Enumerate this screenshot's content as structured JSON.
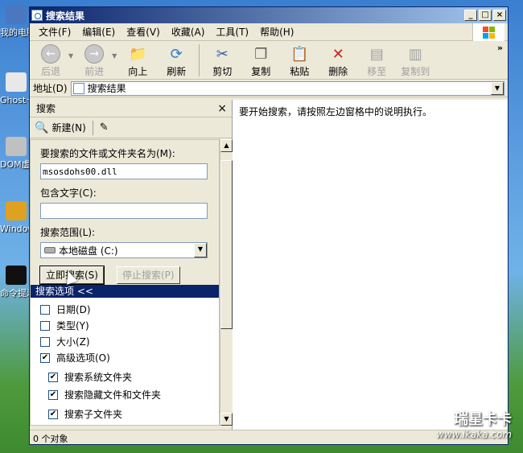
{
  "desktop": {
    "icons": [
      {
        "label": "我的电脑",
        "color": "#4a78c0"
      },
      {
        "label": "Ghost一键还原",
        "color": "#e8e8e8"
      },
      {
        "label": "DOM虚拟光驱",
        "color": "#c0c0c0"
      },
      {
        "label": "Windows密码",
        "color": "#e0a020"
      },
      {
        "label": "命令提示",
        "color": "#101010"
      }
    ]
  },
  "window": {
    "title": "搜索结果",
    "controls": {
      "minimize": "_",
      "maximize": "□",
      "close": "×"
    }
  },
  "menubar": [
    "文件(F)",
    "编辑(E)",
    "查看(V)",
    "收藏(A)",
    "工具(T)",
    "帮助(H)"
  ],
  "toolbar": {
    "back": "后退",
    "forward": "前进",
    "up": "向上",
    "refresh": "刷新",
    "cut": "剪切",
    "copy": "复制",
    "paste": "粘贴",
    "delete": "删除",
    "move": "移至",
    "copyto": "复制到",
    "more": "»"
  },
  "address": {
    "label": "地址(D)",
    "value": "搜索结果"
  },
  "search_panel": {
    "title": "搜索",
    "close": "×",
    "new_label": "新建(N)",
    "filename_label": "要搜索的文件或文件夹名为(M):",
    "filename_value": "msosdohs00.dll",
    "contains_label": "包含文字(C):",
    "contains_value": "",
    "scope_label": "搜索范围(L):",
    "scope_value": "本地磁盘 (C:)",
    "search_btn": "立即搜索(S)",
    "stop_btn": "停止搜索(P)",
    "options_title": "搜索选项 <<",
    "options": [
      {
        "label": "日期(D)",
        "checked": false
      },
      {
        "label": "类型(Y)",
        "checked": false
      },
      {
        "label": "大小(Z)",
        "checked": false
      },
      {
        "label": "高级选项(O)",
        "checked": true
      }
    ],
    "advanced": [
      {
        "label": "搜索系统文件夹",
        "checked": true
      },
      {
        "label": "搜索隐藏文件和文件夹",
        "checked": true
      },
      {
        "label": "搜索子文件夹",
        "checked": true
      }
    ]
  },
  "results_text": "要开始搜索，请按照左边窗格中的说明执行。",
  "status": "0 个对象",
  "watermark": {
    "logo": "瑞星卡卡",
    "url": "www.ikaka.com"
  }
}
